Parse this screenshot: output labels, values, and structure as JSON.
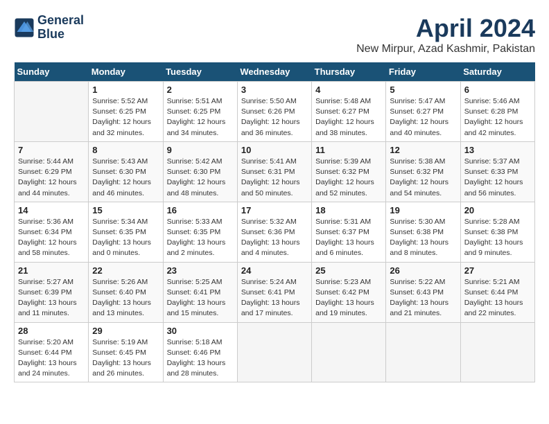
{
  "header": {
    "logo_line1": "General",
    "logo_line2": "Blue",
    "title": "April 2024",
    "subtitle": "New Mirpur, Azad Kashmir, Pakistan"
  },
  "weekdays": [
    "Sunday",
    "Monday",
    "Tuesday",
    "Wednesday",
    "Thursday",
    "Friday",
    "Saturday"
  ],
  "weeks": [
    [
      {
        "day": "",
        "info": ""
      },
      {
        "day": "1",
        "info": "Sunrise: 5:52 AM\nSunset: 6:25 PM\nDaylight: 12 hours\nand 32 minutes."
      },
      {
        "day": "2",
        "info": "Sunrise: 5:51 AM\nSunset: 6:25 PM\nDaylight: 12 hours\nand 34 minutes."
      },
      {
        "day": "3",
        "info": "Sunrise: 5:50 AM\nSunset: 6:26 PM\nDaylight: 12 hours\nand 36 minutes."
      },
      {
        "day": "4",
        "info": "Sunrise: 5:48 AM\nSunset: 6:27 PM\nDaylight: 12 hours\nand 38 minutes."
      },
      {
        "day": "5",
        "info": "Sunrise: 5:47 AM\nSunset: 6:27 PM\nDaylight: 12 hours\nand 40 minutes."
      },
      {
        "day": "6",
        "info": "Sunrise: 5:46 AM\nSunset: 6:28 PM\nDaylight: 12 hours\nand 42 minutes."
      }
    ],
    [
      {
        "day": "7",
        "info": "Sunrise: 5:44 AM\nSunset: 6:29 PM\nDaylight: 12 hours\nand 44 minutes."
      },
      {
        "day": "8",
        "info": "Sunrise: 5:43 AM\nSunset: 6:30 PM\nDaylight: 12 hours\nand 46 minutes."
      },
      {
        "day": "9",
        "info": "Sunrise: 5:42 AM\nSunset: 6:30 PM\nDaylight: 12 hours\nand 48 minutes."
      },
      {
        "day": "10",
        "info": "Sunrise: 5:41 AM\nSunset: 6:31 PM\nDaylight: 12 hours\nand 50 minutes."
      },
      {
        "day": "11",
        "info": "Sunrise: 5:39 AM\nSunset: 6:32 PM\nDaylight: 12 hours\nand 52 minutes."
      },
      {
        "day": "12",
        "info": "Sunrise: 5:38 AM\nSunset: 6:32 PM\nDaylight: 12 hours\nand 54 minutes."
      },
      {
        "day": "13",
        "info": "Sunrise: 5:37 AM\nSunset: 6:33 PM\nDaylight: 12 hours\nand 56 minutes."
      }
    ],
    [
      {
        "day": "14",
        "info": "Sunrise: 5:36 AM\nSunset: 6:34 PM\nDaylight: 12 hours\nand 58 minutes."
      },
      {
        "day": "15",
        "info": "Sunrise: 5:34 AM\nSunset: 6:35 PM\nDaylight: 13 hours\nand 0 minutes."
      },
      {
        "day": "16",
        "info": "Sunrise: 5:33 AM\nSunset: 6:35 PM\nDaylight: 13 hours\nand 2 minutes."
      },
      {
        "day": "17",
        "info": "Sunrise: 5:32 AM\nSunset: 6:36 PM\nDaylight: 13 hours\nand 4 minutes."
      },
      {
        "day": "18",
        "info": "Sunrise: 5:31 AM\nSunset: 6:37 PM\nDaylight: 13 hours\nand 6 minutes."
      },
      {
        "day": "19",
        "info": "Sunrise: 5:30 AM\nSunset: 6:38 PM\nDaylight: 13 hours\nand 8 minutes."
      },
      {
        "day": "20",
        "info": "Sunrise: 5:28 AM\nSunset: 6:38 PM\nDaylight: 13 hours\nand 9 minutes."
      }
    ],
    [
      {
        "day": "21",
        "info": "Sunrise: 5:27 AM\nSunset: 6:39 PM\nDaylight: 13 hours\nand 11 minutes."
      },
      {
        "day": "22",
        "info": "Sunrise: 5:26 AM\nSunset: 6:40 PM\nDaylight: 13 hours\nand 13 minutes."
      },
      {
        "day": "23",
        "info": "Sunrise: 5:25 AM\nSunset: 6:41 PM\nDaylight: 13 hours\nand 15 minutes."
      },
      {
        "day": "24",
        "info": "Sunrise: 5:24 AM\nSunset: 6:41 PM\nDaylight: 13 hours\nand 17 minutes."
      },
      {
        "day": "25",
        "info": "Sunrise: 5:23 AM\nSunset: 6:42 PM\nDaylight: 13 hours\nand 19 minutes."
      },
      {
        "day": "26",
        "info": "Sunrise: 5:22 AM\nSunset: 6:43 PM\nDaylight: 13 hours\nand 21 minutes."
      },
      {
        "day": "27",
        "info": "Sunrise: 5:21 AM\nSunset: 6:44 PM\nDaylight: 13 hours\nand 22 minutes."
      }
    ],
    [
      {
        "day": "28",
        "info": "Sunrise: 5:20 AM\nSunset: 6:44 PM\nDaylight: 13 hours\nand 24 minutes."
      },
      {
        "day": "29",
        "info": "Sunrise: 5:19 AM\nSunset: 6:45 PM\nDaylight: 13 hours\nand 26 minutes."
      },
      {
        "day": "30",
        "info": "Sunrise: 5:18 AM\nSunset: 6:46 PM\nDaylight: 13 hours\nand 28 minutes."
      },
      {
        "day": "",
        "info": ""
      },
      {
        "day": "",
        "info": ""
      },
      {
        "day": "",
        "info": ""
      },
      {
        "day": "",
        "info": ""
      }
    ]
  ]
}
